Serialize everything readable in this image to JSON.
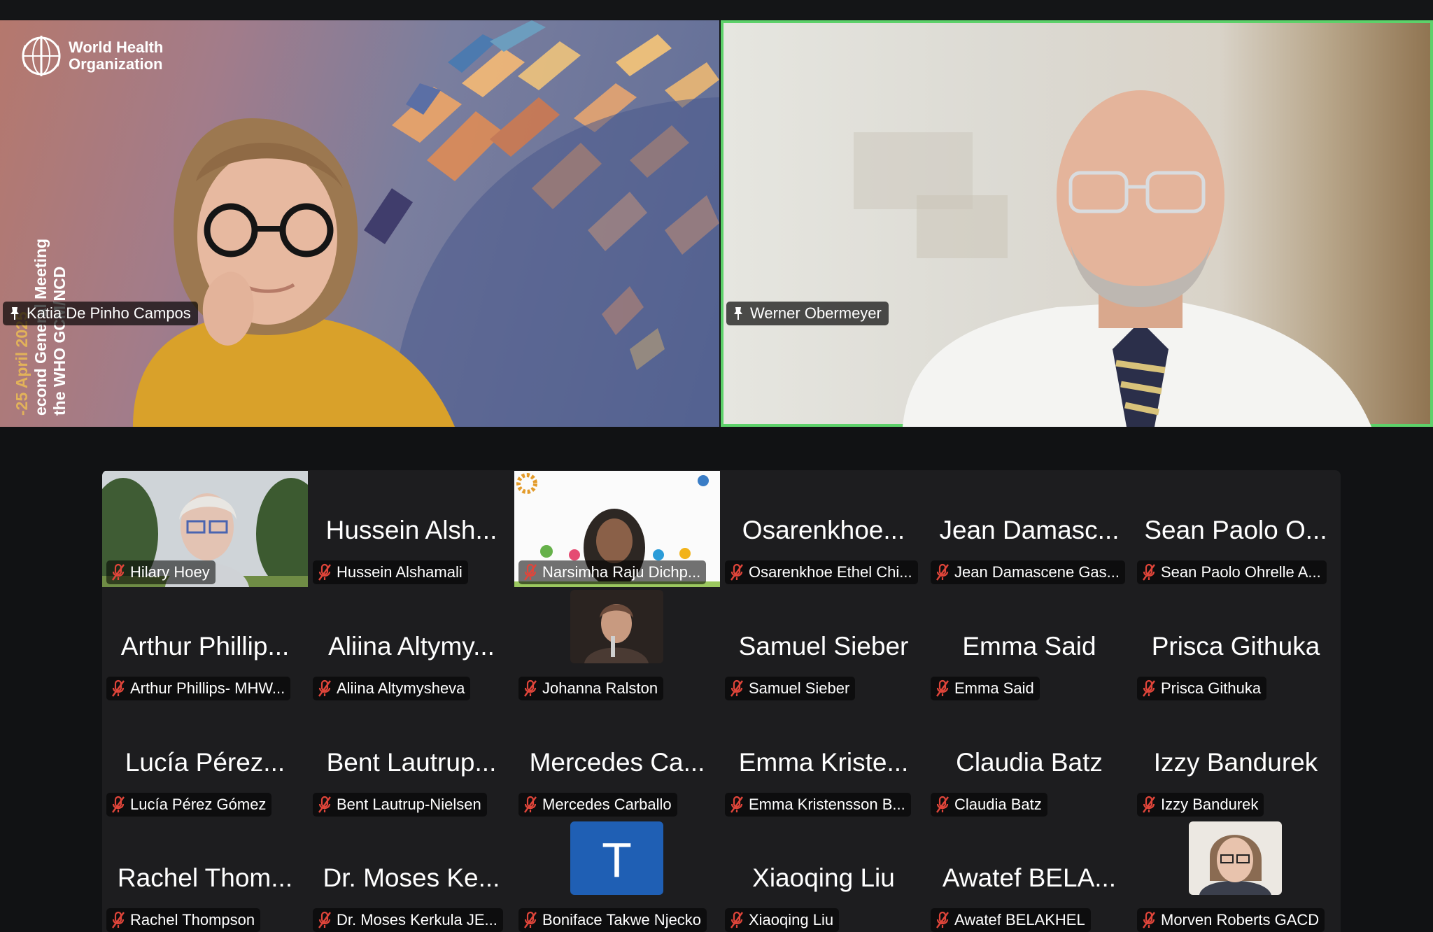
{
  "speakers": [
    {
      "name": "Katia De Pinho Campos",
      "active": false
    },
    {
      "name": "Werner Obermeyer",
      "active": true
    }
  ],
  "slide": {
    "org_name": "World Health Organization",
    "line1": "-25 April 2025",
    "line2": "econd General Meeting",
    "line3": "the WHO GCM/NCD"
  },
  "gallery": [
    {
      "big": "",
      "name": "Hilary Hoey",
      "video": "photo-outdoor"
    },
    {
      "big": "Hussein Alsh...",
      "name": "Hussein Alshamali"
    },
    {
      "big": "",
      "name": "Narsimha Raju Dichp...",
      "video": "who-slide"
    },
    {
      "big": "Osarenkhoe...",
      "name": "Osarenkhoe Ethel Chi..."
    },
    {
      "big": "Jean Damasc...",
      "name": "Jean Damascene Gas..."
    },
    {
      "big": "Sean Paolo O...",
      "name": "Sean Paolo Ohrelle A..."
    },
    {
      "big": "Arthur Phillip...",
      "name": "Arthur Phillips- MHW..."
    },
    {
      "big": "Aliina Altymy...",
      "name": "Aliina Altymysheva"
    },
    {
      "big": "",
      "name": "Johanna Ralston",
      "video": "small"
    },
    {
      "big": "Samuel Sieber",
      "name": "Samuel Sieber"
    },
    {
      "big": "Emma Said",
      "name": "Emma Said"
    },
    {
      "big": "Prisca Githuka",
      "name": "Prisca Githuka"
    },
    {
      "big": "Lucía Pérez...",
      "name": "Lucía Pérez Gómez"
    },
    {
      "big": "Bent Lautrup...",
      "name": "Bent Lautrup-Nielsen"
    },
    {
      "big": "Mercedes Ca...",
      "name": "Mercedes Carballo"
    },
    {
      "big": "Emma Kriste...",
      "name": "Emma Kristensson B..."
    },
    {
      "big": "Claudia Batz",
      "name": "Claudia Batz"
    },
    {
      "big": "Izzy Bandurek",
      "name": "Izzy Bandurek"
    },
    {
      "big": "Rachel Thom...",
      "name": "Rachel Thompson"
    },
    {
      "big": "Dr. Moses Ke...",
      "name": "Dr. Moses Kerkula JE..."
    },
    {
      "big": "",
      "name": "Boniface Takwe Njecko",
      "avatar_letter": "T"
    },
    {
      "big": "Xiaoqing Liu",
      "name": "Xiaoqing Liu"
    },
    {
      "big": "Awatef BELA...",
      "name": "Awatef BELAKHEL"
    },
    {
      "big": "",
      "name": "Morven Roberts GACD",
      "video": "small2"
    }
  ],
  "colors": {
    "active_speaker_border": "#5dd16a",
    "mute_icon": "#e0453a",
    "avatar_bg": "#1f5fb4"
  }
}
